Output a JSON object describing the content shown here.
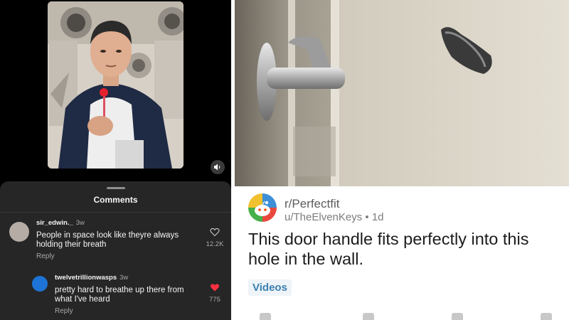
{
  "instagram": {
    "sheet_title": "Comments",
    "comments": [
      {
        "username": "sir_edwin._",
        "time": "3w",
        "text": "People in space look like theyre always holding their breath",
        "reply_label": "Reply",
        "likes": "12.2K",
        "liked": false
      },
      {
        "username": "twelvetrillionwasps",
        "time": "3w",
        "text": "pretty hard to breathe up there from what I've heard",
        "reply_label": "Reply",
        "likes": "775",
        "liked": true
      }
    ],
    "colors": {
      "background": "#000000",
      "sheet": "#262626",
      "heart": "#ff3040"
    },
    "icons": [
      "speaker-icon",
      "heart-outline-icon",
      "heart-filled-icon"
    ]
  },
  "reddit": {
    "subreddit": "r/Perfectfit",
    "user": "u/TheElvenKeys",
    "separator": "•",
    "age": "1d",
    "title": "This door handle fits perfectly into this hole in the wall.",
    "flair": "Videos",
    "colors": {
      "flair_text": "#3c7fb0",
      "flair_bg": "#eef4f8"
    },
    "icons": [
      "subreddit-icon",
      "upvote-icon",
      "comment-icon",
      "share-icon"
    ]
  }
}
